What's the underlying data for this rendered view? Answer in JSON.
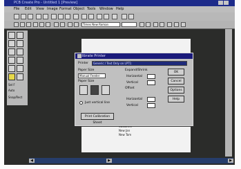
{
  "window": {
    "title": "PCB Create Pro - Untitled 1 [Preview]"
  },
  "menu": [
    "File",
    "Edit",
    "View",
    "Image",
    "Format",
    "Object",
    "Tools",
    "Window",
    "Help"
  ],
  "toolbar2": {
    "font_combo": "Times New Roman"
  },
  "palette": {
    "label1": "Sel F",
    "label2": "Auto",
    "label3": "Snap/Rect"
  },
  "dialog": {
    "title": "Calibrate Printer",
    "printer_label": "Printer",
    "printer_value": "Generic / Text Only on LPT1:",
    "paper_label": "Paper Size",
    "paper_value": "Manual Feeder",
    "source_label": "Paper Size",
    "expand_label": "Expand/Shrink",
    "horizontal_label": "Horizontal",
    "vertical_label": "Vertical",
    "offset_label": "Offset",
    "horizontal2_label": "Horizontal",
    "vertical2_label": "Vertical",
    "checkbox_label": "Just vertical line",
    "print_button": "Print Calibration Sheet",
    "ok_button": "OK",
    "cancel_button": "Cancel",
    "options_button": "Options",
    "help_button": "Help"
  },
  "document": {
    "line1": "Customer",
    "line2": "New Jan",
    "line3": "New Tom"
  }
}
